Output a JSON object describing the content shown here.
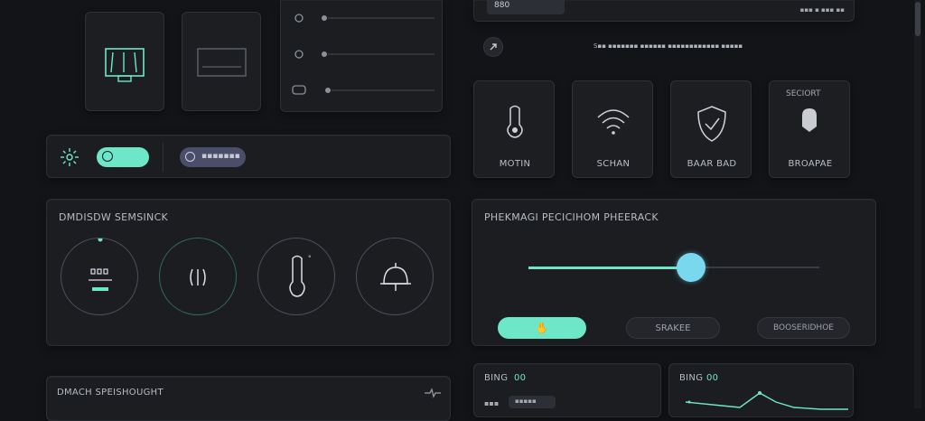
{
  "accent_color": "#6ee7c8",
  "secondary_color": "#4b4e68",
  "top_right": {
    "input_value": "880",
    "header_text": "▪▪▪ ▪ ▪▪▪ ▪▪",
    "info_text": "S▪▪ ▪▪▪▪▪▪▪ ▪▪▪▪▪▪ ▪▪▪▪▪▪▪▪▪▪▪▪ ▪▪▪▪▪"
  },
  "toggle_row": {
    "secondary_pill_label": "▪▪▪▪▪▪▪"
  },
  "device_section": {
    "title": "DMDISDW SEMSINCK"
  },
  "device_tiles": [
    {
      "label": "MOTIN"
    },
    {
      "label": "SCHAN"
    },
    {
      "label": "BAAR BAD"
    },
    {
      "label": "BROAPAE",
      "header": "SECIORT"
    }
  ],
  "preset_section": {
    "title": "PHEKMAGI PECICIHOM PHEERACK",
    "slider_value": 0.56,
    "buttons": [
      {
        "label": "✋"
      },
      {
        "label": "SRAKEE"
      },
      {
        "label": "BOOSERIDHOE"
      }
    ]
  },
  "bottom_left": {
    "title": "DMACH SPEISHOUGHT"
  },
  "bottom_cards": [
    {
      "title": "BING",
      "value": "00",
      "chip": "▪▪▪▪▪"
    },
    {
      "title": "BING",
      "value": "00"
    }
  ]
}
